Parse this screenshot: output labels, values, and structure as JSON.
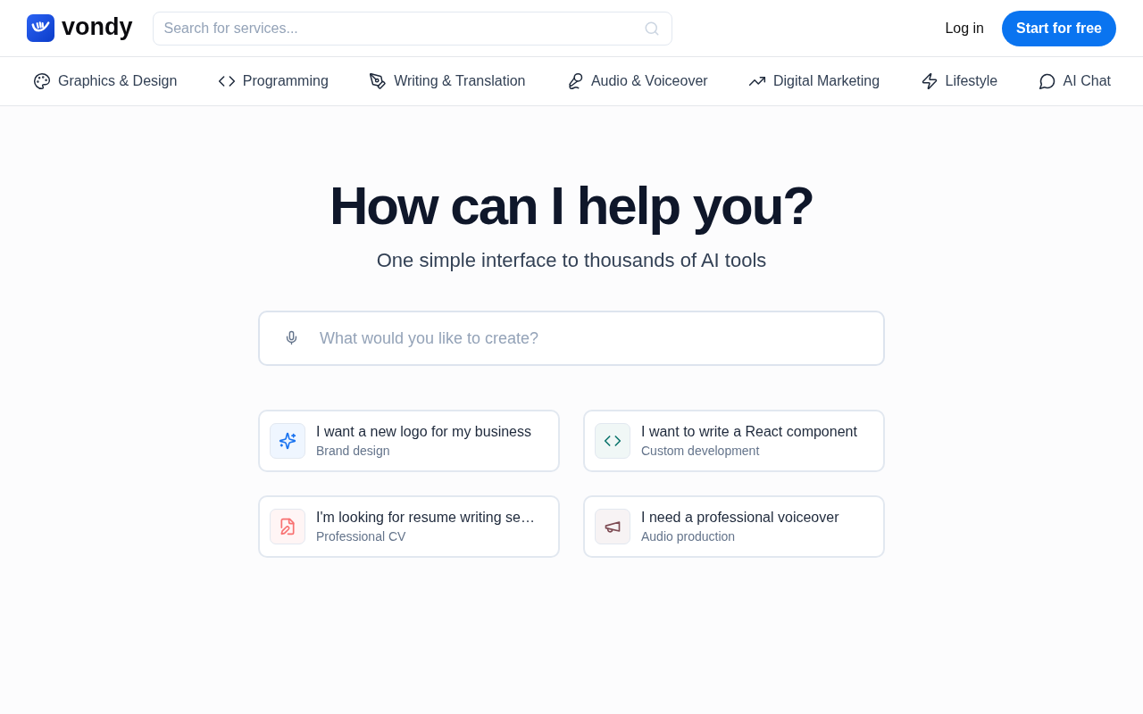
{
  "header": {
    "wordmark": "vondy",
    "search": {
      "placeholder": "Search for services..."
    },
    "login": "Log in",
    "cta": "Start for free"
  },
  "categories": [
    {
      "label": "Graphics & Design"
    },
    {
      "label": "Programming"
    },
    {
      "label": "Writing & Translation"
    },
    {
      "label": "Audio & Voiceover"
    },
    {
      "label": "Digital Marketing"
    },
    {
      "label": "Lifestyle"
    },
    {
      "label": "AI Chat"
    }
  ],
  "hero": {
    "title": "How can I help you?",
    "subtitle": "One simple interface to thousands of AI tools"
  },
  "prompt": {
    "placeholder": "What would you like to create?"
  },
  "suggestions": [
    {
      "title": "I want a new logo for my business",
      "subtitle": "Brand design"
    },
    {
      "title": "I want to write a React component",
      "subtitle": "Custom development"
    },
    {
      "title": "I'm looking for resume writing se…",
      "subtitle": "Professional CV"
    },
    {
      "title": "I need a professional voiceover",
      "subtitle": "Audio production"
    }
  ]
}
